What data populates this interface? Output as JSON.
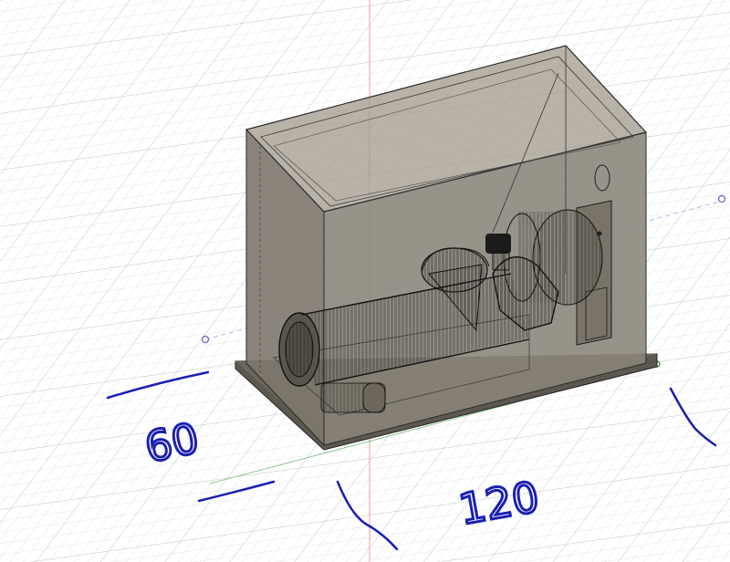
{
  "viewport": {
    "background": "#ffffff",
    "grid_color": "#d9dde2",
    "grid_major_color": "#c4c9cf",
    "axis_colors": {
      "x": "#e05a5a",
      "y": "#4c9a4c",
      "z": "#7a74d6"
    },
    "model": {
      "body_color": "#847c6f",
      "edge_color": "#2b2b2b",
      "wireframe_color": "#111111"
    }
  },
  "annotations": {
    "ink_color": "#1b1fb0",
    "depth_dimension": "60",
    "width_dimension": "120"
  }
}
